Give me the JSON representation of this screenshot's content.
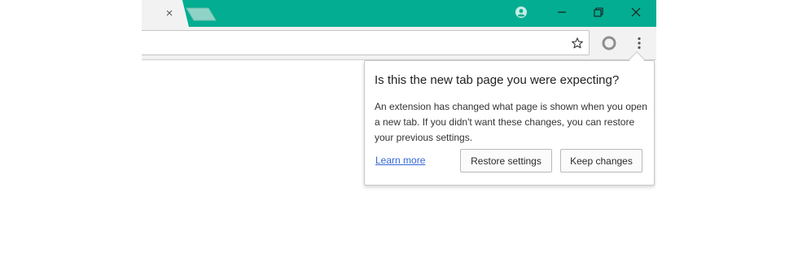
{
  "colors": {
    "tabstrip": "#03ad91",
    "toolbar": "#f2f2f2",
    "link": "#3367d6"
  },
  "tabstrip": {
    "tab_close_glyph": "×",
    "new_tab_icon": "new-tab-icon",
    "profile_icon": "profile-icon",
    "window_controls": {
      "minimize_icon": "minimize-icon",
      "restore_icon": "restore-icon",
      "close_icon": "close-icon"
    }
  },
  "toolbar": {
    "bookmark_icon": "star-icon",
    "extension_icon": "extension-icon",
    "menu_icon": "more-vert-icon"
  },
  "bubble": {
    "title": "Is this the new tab page you were expecting?",
    "body": "An extension has changed what page is shown when you open a new tab. If you didn't want these changes, you can restore your previous settings.",
    "learn_more": "Learn more",
    "restore_label": "Restore settings",
    "keep_label": "Keep changes"
  }
}
